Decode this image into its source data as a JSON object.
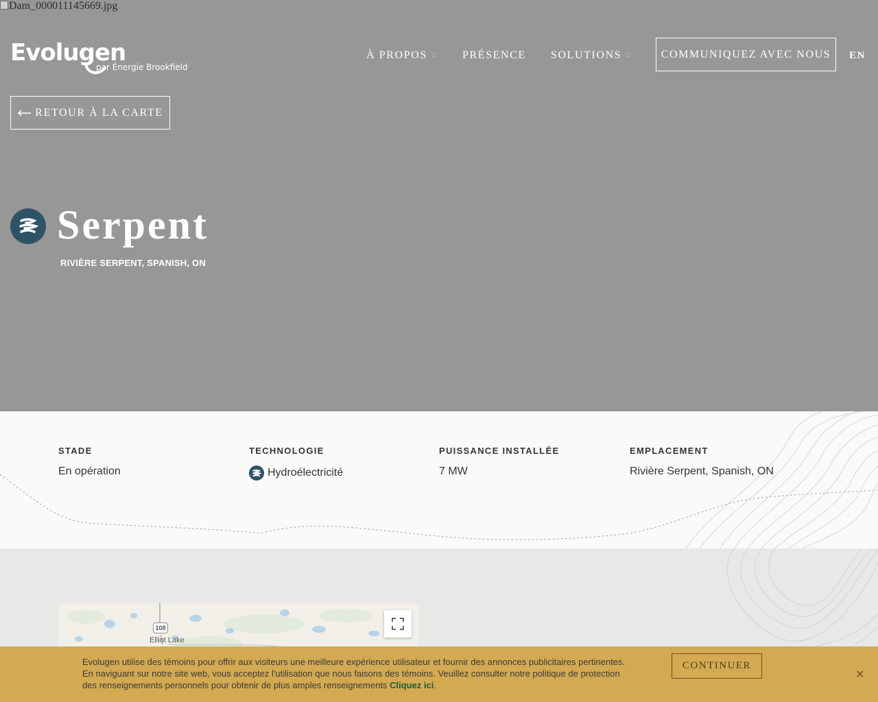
{
  "hero": {
    "image_alt": "Dam_000011145669.jpg",
    "background": "#979795"
  },
  "header": {
    "logo_word": "Evolugen",
    "logo_sub": "par Énergie Brookfield",
    "nav": [
      {
        "label": "À PROPOS",
        "has_dropdown": true
      },
      {
        "label": "PRÉSENCE",
        "has_dropdown": false
      },
      {
        "label": "SOLUTIONS",
        "has_dropdown": true
      }
    ],
    "cta_label": "COMMUNIQUEZ AVEC NOUS",
    "lang_label": "EN"
  },
  "back_button": {
    "label": "RETOUR À LA CARTE",
    "icon": "arrow-left-icon"
  },
  "project": {
    "title": "Serpent",
    "subtitle": "RIVIÈRE SERPENT, SPANISH, ON",
    "icon": "hydro-waves-icon",
    "icon_color": "#2e5266"
  },
  "facts": [
    {
      "label": "STADE",
      "value": "En opération"
    },
    {
      "label": "TECHNOLOGIE",
      "value": "Hydroélectricité",
      "icon": "hydro-waves-icon"
    },
    {
      "label": "PUISSANCE INSTALLÉE",
      "value": "7 MW"
    },
    {
      "label": "EMPLACEMENT",
      "value": "Rivière Serpent, Spanish, ON"
    }
  ],
  "map": {
    "road_shield": "108",
    "town_label": "Elliot Lake",
    "fullscreen_icon": "fullscreen-icon"
  },
  "cookie": {
    "text": "Evolugen utilise des témoins pour offrir aux visiteurs une meilleure expérience utilisateur et fournir des annonces publicitaires pertinentes. En naviguant sur notre site web, vous acceptez l'utilisation que nous faisons des témoins. Veuillez consulter notre politique de protection des renseignements personnels pour obtenir de plus amples renseignements ",
    "link_label": "Cliquez ici",
    "link_suffix": ".",
    "button_label": "CONTINUER",
    "close_label": "✕",
    "background": "#d3a952"
  }
}
